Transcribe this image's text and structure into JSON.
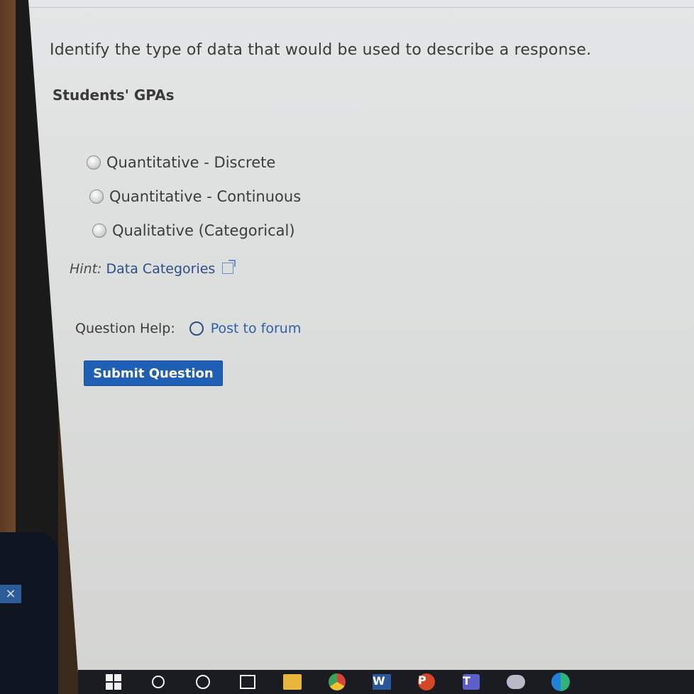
{
  "question": {
    "prompt": "Identify the type of data that would be used to describe a response.",
    "subject": "Students' GPAs"
  },
  "options": [
    {
      "label": "Quantitative - Discrete",
      "selected": false
    },
    {
      "label": "Quantitative - Continuous",
      "selected": false
    },
    {
      "label": "Qualitative (Categorical)",
      "selected": false
    }
  ],
  "hint": {
    "label": "Hint:",
    "link": "Data Categories"
  },
  "help": {
    "label": "Question Help:",
    "forum_link": "Post to forum"
  },
  "submit_label": "Submit Question",
  "taskbar": {
    "word_letter": "W",
    "ppt_letter": "P",
    "teams_letter": "T"
  },
  "phone_overlay": "×",
  "colors": {
    "submit_bg": "#1f5fb4",
    "link": "#2f5fa6",
    "page_bg": "#dcdedd",
    "taskbar_bg": "#1b1c22"
  }
}
